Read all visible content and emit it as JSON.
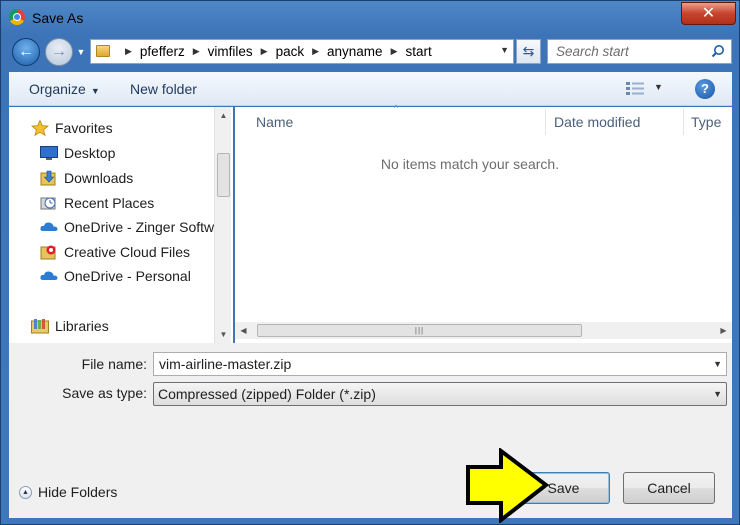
{
  "window": {
    "title": "Save As",
    "close_glyph": "✕"
  },
  "nav": {
    "back_glyph": "←",
    "forward_glyph": "→",
    "history_glyph": "▼"
  },
  "address": {
    "crumbs": [
      "pfefferz",
      "vimfiles",
      "pack",
      "anyname",
      "start"
    ],
    "separator": "▶",
    "dropdown_glyph": "▼",
    "refresh_glyph": "⇆"
  },
  "search": {
    "placeholder": "Search start",
    "icon": "search-icon"
  },
  "toolbar": {
    "organize_label": "Organize",
    "organize_arrow": "▼",
    "new_folder_label": "New folder",
    "view_drop": "▼",
    "help_glyph": "?"
  },
  "sidebar": {
    "items": [
      {
        "label": "Favorites",
        "icon": "star-icon"
      },
      {
        "label": "Desktop",
        "icon": "desktop-icon"
      },
      {
        "label": "Downloads",
        "icon": "downloads-icon"
      },
      {
        "label": "Recent Places",
        "icon": "recent-places-icon"
      },
      {
        "label": "OneDrive - Zinger Software",
        "icon": "cloud-icon"
      },
      {
        "label": "Creative Cloud Files",
        "icon": "creative-cloud-icon"
      },
      {
        "label": "OneDrive - Personal",
        "icon": "cloud-icon"
      },
      {
        "label": "Libraries",
        "icon": "libraries-icon"
      }
    ]
  },
  "file_list": {
    "columns": [
      "Name",
      "Date modified",
      "Type"
    ],
    "sort_caret": "^",
    "empty_message": "No items match your search."
  },
  "scroll": {
    "up": "▲",
    "down": "▼",
    "left": "◀",
    "right": "▶",
    "grip": "|||"
  },
  "form": {
    "file_name_label": "File name:",
    "file_name_value": "vim-airline-master.zip",
    "save_type_label": "Save as type:",
    "save_type_value": "Compressed (zipped) Folder (*.zip)",
    "dropdown_glyph": "▼"
  },
  "footer": {
    "hide_folders_label": "Hide Folders",
    "hide_folders_glyph": "▲",
    "save_label": "Save",
    "cancel_label": "Cancel"
  },
  "colors": {
    "frame": "#3c74b7",
    "arrow_fill": "#ffff00",
    "default_button_border": "#3c7fb1"
  }
}
